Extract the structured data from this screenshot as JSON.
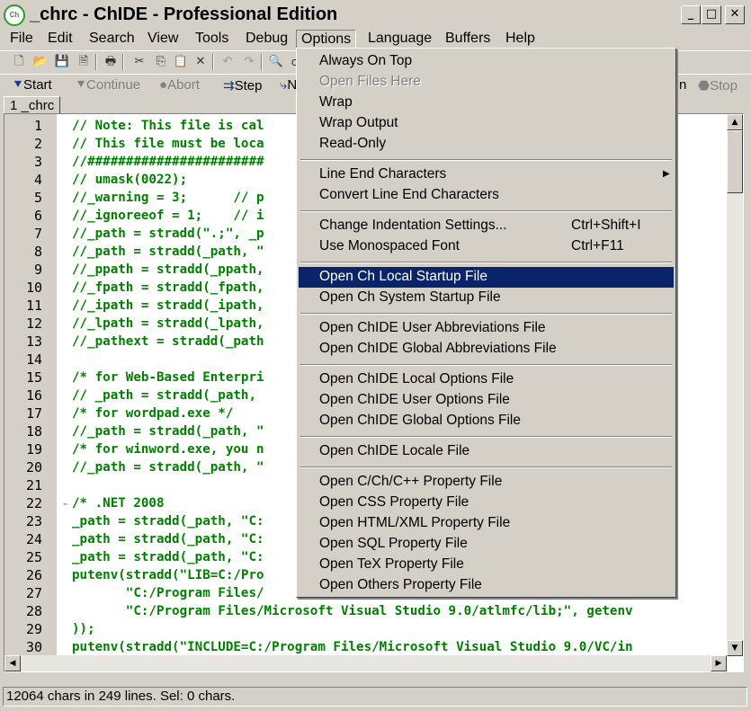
{
  "window": {
    "title": "_chrc - ChIDE - Professional Edition",
    "app_icon_text": "Ch",
    "buttons": {
      "minimize": "_",
      "maximize": "□",
      "close": "✕"
    }
  },
  "menubar": [
    "File",
    "Edit",
    "Search",
    "View",
    "Tools",
    "Debug",
    "Options",
    "Language",
    "Buffers",
    "Help"
  ],
  "toolbar_debug": {
    "start": "Start",
    "continue": "Continue",
    "abort": "Abort",
    "step": "Step",
    "next_partial": "N",
    "partial_right": "n",
    "stop": "Stop"
  },
  "tab": {
    "label": "1 _chrc"
  },
  "options_menu": {
    "items": [
      {
        "label": "Always On Top",
        "shortcut": "",
        "disabled": false
      },
      {
        "label": "Open Files Here",
        "shortcut": "",
        "disabled": true
      },
      {
        "label": "Wrap",
        "shortcut": "",
        "disabled": false
      },
      {
        "label": "Wrap Output",
        "shortcut": "",
        "disabled": false
      },
      {
        "label": "Read-Only",
        "shortcut": "",
        "disabled": false
      },
      {
        "label": "Line End Characters",
        "shortcut": "",
        "submenu": true
      },
      {
        "label": "Convert Line End Characters",
        "shortcut": ""
      },
      {
        "label": "Change Indentation Settings...",
        "shortcut": "Ctrl+Shift+I"
      },
      {
        "label": "Use Monospaced Font",
        "shortcut": "Ctrl+F11"
      },
      {
        "label": "Open Ch Local Startup File",
        "shortcut": "",
        "highlighted": true
      },
      {
        "label": "Open Ch System Startup File",
        "shortcut": ""
      },
      {
        "label": "Open ChIDE User Abbreviations File",
        "shortcut": ""
      },
      {
        "label": "Open ChIDE Global Abbreviations File",
        "shortcut": ""
      },
      {
        "label": "Open ChIDE Local Options File",
        "shortcut": ""
      },
      {
        "label": "Open ChIDE User Options File",
        "shortcut": ""
      },
      {
        "label": "Open ChIDE Global Options File",
        "shortcut": ""
      },
      {
        "label": "Open ChIDE Locale File",
        "shortcut": ""
      },
      {
        "label": "Open C/Ch/C++ Property File",
        "shortcut": ""
      },
      {
        "label": "Open CSS Property File",
        "shortcut": ""
      },
      {
        "label": "Open HTML/XML Property File",
        "shortcut": ""
      },
      {
        "label": "Open SQL Property File",
        "shortcut": ""
      },
      {
        "label": "Open TeX Property File",
        "shortcut": ""
      },
      {
        "label": "Open Others Property File",
        "shortcut": ""
      }
    ]
  },
  "editor": {
    "lines": [
      {
        "n": "1",
        "text": "// Note: This file is cal                                     ked."
      },
      {
        "n": "2",
        "text": "// This file must be loca                                     ective"
      },
      {
        "n": "3",
        "text": "//#######################                                     ######"
      },
      {
        "n": "4",
        "text": "// umask(0022);"
      },
      {
        "n": "5",
        "text": "//_warning = 3;      // p                                     s warn"
      },
      {
        "n": "6",
        "text": "//_ignoreeof = 1;    // i"
      },
      {
        "n": "7",
        "text": "//_path = stradd(\".;\", _p"
      },
      {
        "n": "8",
        "text": "//_path = stradd(_path, \""
      },
      {
        "n": "9",
        "text": "//_ppath = stradd(_ppath,"
      },
      {
        "n": "10",
        "text": "//_fpath = stradd(_fpath,"
      },
      {
        "n": "11",
        "text": "//_ipath = stradd(_ipath,"
      },
      {
        "n": "12",
        "text": "//_lpath = stradd(_lpath,"
      },
      {
        "n": "13",
        "text": "//_pathext = stradd(_path"
      },
      {
        "n": "14",
        "text": ""
      },
      {
        "n": "15",
        "text": "/* for Web-Based Enterpri                                     tor */"
      },
      {
        "n": "16",
        "text": "// _path = stradd(_path,"
      },
      {
        "n": "17",
        "text": "/* for wordpad.exe */"
      },
      {
        "n": "18",
        "text": "//_path = stradd(_path, \"                                     ;"
      },
      {
        "n": "19",
        "text": "/* for winword.exe, you n                                     on 11"
      },
      {
        "n": "20",
        "text": "//_path = stradd(_path, \"                                     ;\");"
      },
      {
        "n": "21",
        "text": ""
      },
      {
        "n": "22",
        "text": "/* .NET 2008",
        "fold": "-"
      },
      {
        "n": "23",
        "text": "_path = stradd(_path, \"C:                                     /VC/bi"
      },
      {
        "n": "24",
        "text": "_path = stradd(_path, \"C:                                     /COMMO"
      },
      {
        "n": "25",
        "text": "_path = stradd(_path, \"C:                                     a/bin,"
      },
      {
        "n": "26",
        "text": "putenv(stradd(\"LIB=C:/Pro                                     lib;\","
      },
      {
        "n": "27",
        "text": "       \"C:/Program Files/"
      },
      {
        "n": "28",
        "text": "       \"C:/Program Files/Microsoft Visual Studio 9.0/atlmfc/lib;\", getenv"
      },
      {
        "n": "29",
        "text": "));"
      },
      {
        "n": "30",
        "text": "putenv(stradd(\"INCLUDE=C:/Program Files/Microsoft Visual Studio 9.0/VC/in"
      }
    ]
  },
  "statusbar": {
    "text": "12064 chars in 249 lines. Sel: 0 chars."
  }
}
